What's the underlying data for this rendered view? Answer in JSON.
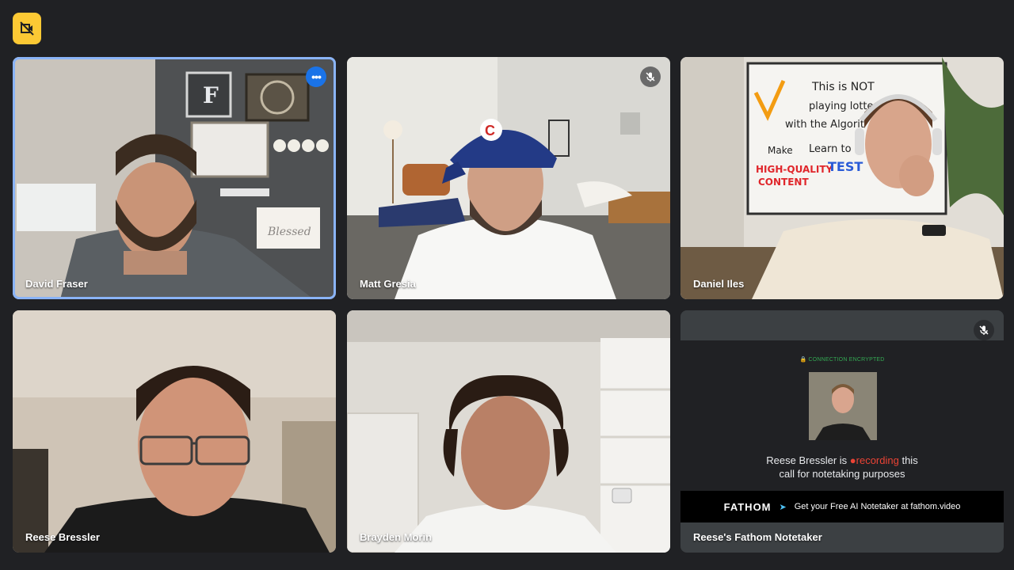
{
  "toolbar": {
    "icon": "video-off-icon",
    "accent": "#fcc934"
  },
  "tiles": [
    {
      "name": "David Fraser",
      "active": true
    },
    {
      "name": "Matt Gresia",
      "muted": true
    },
    {
      "name": "Daniel Iles"
    },
    {
      "name": "Reese Bressler"
    },
    {
      "name": "Brayden Morin"
    },
    {
      "name": "Reese's Fathom Notetaker",
      "muted": true
    }
  ],
  "fathom": {
    "encrypted": "CONNECTION ENCRYPTED",
    "msg_before": "Reese Bressler is",
    "msg_rec": "recording",
    "msg_after": "this",
    "msg_line2": "call for notetaking purposes",
    "brand": "FATHOM",
    "cta": "Get your Free AI Notetaker at",
    "link": "fathom.video"
  },
  "whiteboard": {
    "line1": "This is NOT",
    "line2": "playing lotte",
    "line3": "with the Algorit",
    "make": "Make",
    "learn": "Learn to",
    "hq": "HIGH-QUALITY",
    "content": "CONTENT",
    "test": "TEST"
  },
  "decor": {
    "sign": "Blessed",
    "monogram": "F"
  }
}
